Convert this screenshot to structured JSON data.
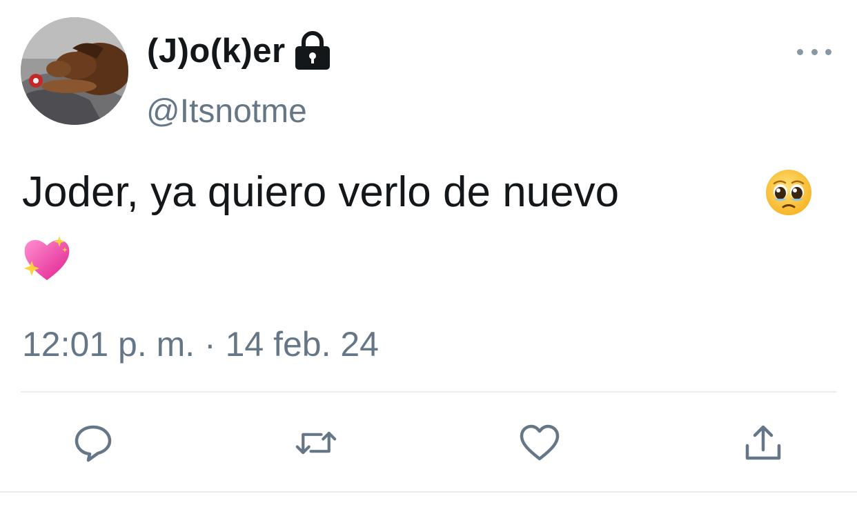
{
  "tweet": {
    "author": {
      "display_name": "(J)o(k)er",
      "handle": "@Itsnotme",
      "protected": true,
      "avatar_icon": "dog-photo-avatar"
    },
    "text": "Joder, ya quiero verlo de nuevo",
    "emojis": [
      "pleading-face-emoji",
      "sparkling-heart-emoji"
    ],
    "timestamp": "12:01 p. m. · 14 feb. 24"
  },
  "actions": [
    {
      "name": "reply",
      "icon": "speech-bubble-icon"
    },
    {
      "name": "retweet",
      "icon": "retweet-arrows-icon"
    },
    {
      "name": "like",
      "icon": "heart-outline-icon"
    },
    {
      "name": "share",
      "icon": "share-upload-icon"
    }
  ],
  "colors": {
    "text_primary": "#14171a",
    "text_secondary": "#657786",
    "icon": "#657786",
    "divider": "#e6ecf0"
  }
}
